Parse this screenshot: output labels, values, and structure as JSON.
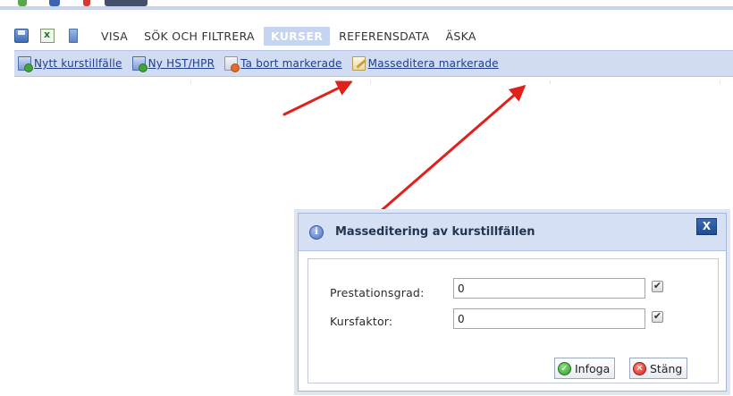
{
  "menu": {
    "items": [
      {
        "label": "VISA",
        "active": false
      },
      {
        "label": "SÖK OCH FILTRERA",
        "active": false
      },
      {
        "label": "KURSER",
        "active": true
      },
      {
        "label": "REFERENSDATA",
        "active": false
      },
      {
        "label": "ÄSKA",
        "active": false
      }
    ],
    "icons": [
      "save-icon",
      "excel-export-icon",
      "document-icon"
    ]
  },
  "toolbar": {
    "buttons": [
      {
        "label": "Nytt kurstillfälle",
        "icon": "new-document-icon"
      },
      {
        "label": "Ny HST/HPR",
        "icon": "new-document-icon"
      },
      {
        "label": "Ta bort markerade",
        "icon": "delete-document-icon"
      },
      {
        "label": "Masseditera markerade",
        "icon": "edit-document-icon"
      }
    ]
  },
  "dialog": {
    "title": "Masseditering av kurstillfällen",
    "close_label": "X",
    "fields": [
      {
        "label": "Prestationsgrad:",
        "value": "0",
        "checked": true
      },
      {
        "label": "Kursfaktor:",
        "value": "0",
        "checked": true
      }
    ],
    "buttons": {
      "submit": "Infoga",
      "close": "Stäng"
    }
  },
  "colors": {
    "toolbar_bg": "#d1dbf1",
    "active_tab_bg": "#c5d4f0",
    "link": "#1f3f8c",
    "arrow": "#e0201a",
    "dialog_header_bg": "#d5e0f4",
    "close_button_bg": "#1f4b95"
  }
}
